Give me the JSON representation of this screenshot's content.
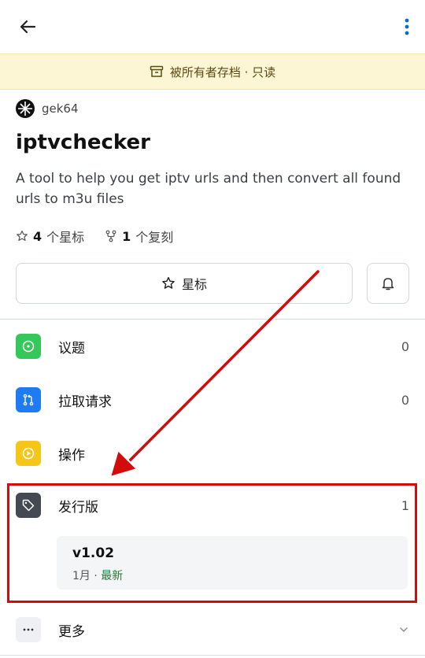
{
  "archived_notice": "被所有者存档 · 只读",
  "owner": "gek64",
  "repo_name": "iptvchecker",
  "description": "A tool to help you get iptv urls and then convert all found urls to m3u files",
  "stats": {
    "stars_count": "4",
    "stars_label": "个星标",
    "forks_count": "1",
    "forks_label": "个复刻"
  },
  "star_button_label": "星标",
  "menu": {
    "issues": {
      "label": "议题",
      "count": "0"
    },
    "pulls": {
      "label": "拉取请求",
      "count": "0"
    },
    "actions": {
      "label": "操作"
    },
    "releases": {
      "label": "发行版",
      "count": "1"
    },
    "more": {
      "label": "更多"
    }
  },
  "latest_release": {
    "version": "v1.02",
    "date": "1月",
    "separator": " · ",
    "latest_tag": "最新"
  },
  "colors": {
    "issues_icon_bg": "#34c759",
    "pulls_icon_bg": "#1f7bf2",
    "actions_icon_bg": "#f5c518",
    "releases_icon_bg": "#454a52",
    "more_icon_bg": "#eef0f3",
    "annotation_red": "#d40b0b",
    "archived_banner_bg": "#fdf6d5",
    "kebab_blue": "#0969da"
  },
  "icons": [
    "back-arrow-icon",
    "kebab-menu-icon",
    "archive-box-icon",
    "star-outline-icon",
    "fork-icon",
    "bell-icon",
    "issue-circle-icon",
    "pull-request-icon",
    "play-circle-icon",
    "tag-icon",
    "ellipsis-icon",
    "chevron-down-icon"
  ]
}
